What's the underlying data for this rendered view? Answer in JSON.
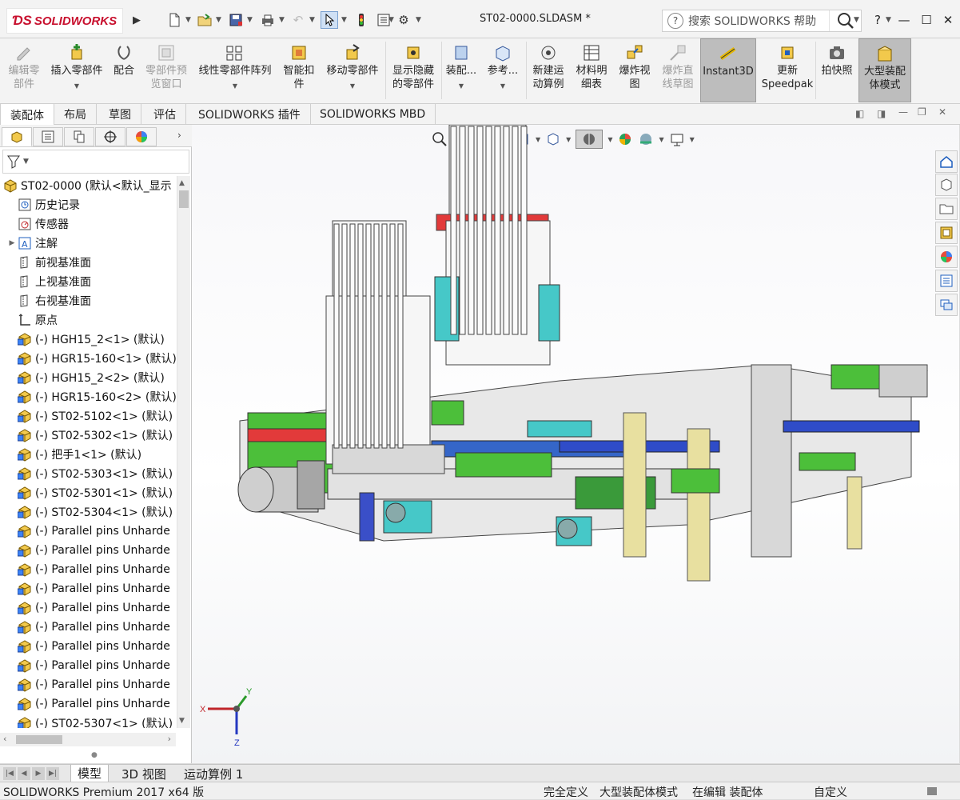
{
  "app": {
    "brand": "SOLIDWORKS",
    "document_title": "ST02-0000.SLDASM *"
  },
  "search": {
    "placeholder": "搜索 SOLIDWORKS 帮助"
  },
  "window_controls": {
    "help": "?",
    "minimize": "—",
    "maximize": "☐",
    "close": "✕"
  },
  "ribbon": {
    "buttons": [
      {
        "label1": "编辑零",
        "label2": "部件",
        "icon": "edit-component-icon",
        "disabled": true
      },
      {
        "label1": "插入零部件",
        "label2": "",
        "icon": "insert-component-icon",
        "disabled": false
      },
      {
        "label1": "配合",
        "label2": "",
        "icon": "mate-icon",
        "disabled": false
      },
      {
        "label1": "零部件预",
        "label2": "览窗口",
        "icon": "component-preview-icon",
        "disabled": true
      },
      {
        "label1": "线性零部件阵列",
        "label2": "",
        "icon": "linear-pattern-icon",
        "disabled": false
      },
      {
        "label1": "智能扣",
        "label2": "件",
        "icon": "smart-fasteners-icon",
        "disabled": false
      },
      {
        "label1": "移动零部件",
        "label2": "",
        "icon": "move-component-icon",
        "disabled": false
      },
      {
        "label1": "显示隐藏",
        "label2": "的零部件",
        "icon": "show-hidden-icon",
        "disabled": false
      },
      {
        "label1": "装配...",
        "label2": "",
        "icon": "assembly-features-icon",
        "disabled": false
      },
      {
        "label1": "参考...",
        "label2": "",
        "icon": "reference-geometry-icon",
        "disabled": false
      },
      {
        "label1": "新建运",
        "label2": "动算例",
        "icon": "new-motion-study-icon",
        "disabled": false
      },
      {
        "label1": "材料明",
        "label2": "细表",
        "icon": "bill-of-materials-icon",
        "disabled": false
      },
      {
        "label1": "爆炸视",
        "label2": "图",
        "icon": "exploded-view-icon",
        "disabled": false
      },
      {
        "label1": "爆炸直",
        "label2": "线草图",
        "icon": "explode-line-sketch-icon",
        "disabled": true
      },
      {
        "label1": "Instant3D",
        "label2": "",
        "icon": "instant3d-icon",
        "disabled": false,
        "active": true
      },
      {
        "label1": "更新",
        "label2": "Speedpak",
        "icon": "speedpak-icon",
        "disabled": false
      },
      {
        "label1": "拍快照",
        "label2": "",
        "icon": "snapshot-icon",
        "disabled": false
      },
      {
        "label1": "大型装配",
        "label2": "体模式",
        "icon": "large-assembly-icon",
        "disabled": false,
        "active": true
      }
    ]
  },
  "command_tabs": [
    "装配体",
    "布局",
    "草图",
    "评估",
    "SOLIDWORKS 插件",
    "SOLIDWORKS MBD"
  ],
  "feature_tree": {
    "root": "ST02-0000  (默认<默认_显示",
    "items": [
      {
        "label": "历史记录",
        "icon": "history-icon",
        "expand": false
      },
      {
        "label": "传感器",
        "icon": "sensor-icon",
        "expand": false
      },
      {
        "label": "注解",
        "icon": "annotations-icon",
        "expand": true
      },
      {
        "label": "前视基准面",
        "icon": "plane-icon",
        "expand": false
      },
      {
        "label": "上视基准面",
        "icon": "plane-icon",
        "expand": false
      },
      {
        "label": "右视基准面",
        "icon": "plane-icon",
        "expand": false
      },
      {
        "label": "原点",
        "icon": "origin-icon",
        "expand": false
      },
      {
        "label": "(-) HGH15_2<1> (默认)",
        "icon": "part-icon",
        "expand": false
      },
      {
        "label": "(-) HGR15-160<1> (默认)",
        "icon": "part-icon",
        "expand": false
      },
      {
        "label": "(-) HGH15_2<2> (默认)",
        "icon": "part-icon",
        "expand": false
      },
      {
        "label": "(-) HGR15-160<2> (默认)",
        "icon": "part-icon",
        "expand": false
      },
      {
        "label": "(-) ST02-5102<1> (默认)",
        "icon": "part-icon",
        "expand": false
      },
      {
        "label": "(-) ST02-5302<1> (默认)",
        "icon": "part-icon",
        "expand": false
      },
      {
        "label": "(-) 把手1<1> (默认)",
        "icon": "part-icon",
        "expand": false
      },
      {
        "label": "(-) ST02-5303<1> (默认)",
        "icon": "part-icon",
        "expand": false
      },
      {
        "label": "(-) ST02-5301<1> (默认)",
        "icon": "part-icon",
        "expand": false
      },
      {
        "label": "(-) ST02-5304<1> (默认)",
        "icon": "part-icon",
        "expand": false
      },
      {
        "label": "(-) Parallel pins Unharde",
        "icon": "part-icon",
        "expand": false
      },
      {
        "label": "(-) Parallel pins Unharde",
        "icon": "part-icon",
        "expand": false
      },
      {
        "label": "(-) Parallel pins Unharde",
        "icon": "part-icon",
        "expand": false
      },
      {
        "label": "(-) Parallel pins Unharde",
        "icon": "part-icon",
        "expand": false
      },
      {
        "label": "(-) Parallel pins Unharde",
        "icon": "part-icon",
        "expand": false
      },
      {
        "label": "(-) Parallel pins Unharde",
        "icon": "part-icon",
        "expand": false
      },
      {
        "label": "(-) Parallel pins Unharde",
        "icon": "part-icon",
        "expand": false
      },
      {
        "label": "(-) Parallel pins Unharde",
        "icon": "part-icon",
        "expand": false
      },
      {
        "label": "(-) Parallel pins Unharde",
        "icon": "part-icon",
        "expand": false
      },
      {
        "label": "(-) Parallel pins Unharde",
        "icon": "part-icon",
        "expand": false
      },
      {
        "label": "(-) ST02-5307<1> (默认)",
        "icon": "part-icon",
        "expand": false
      }
    ]
  },
  "triad": {
    "x": "X",
    "y": "Y",
    "z": "Z"
  },
  "bottom_tabs": [
    "模型",
    "3D 视图",
    "运动算例 1"
  ],
  "status_bar": {
    "product": "SOLIDWORKS Premium 2017 x64 版",
    "definition": "完全定义",
    "mode": "大型装配体模式",
    "editing": "在编辑 装配体",
    "units": "自定义"
  },
  "colors": {
    "brand_red": "#c8102e",
    "accent_blue": "#1f5fbf"
  }
}
